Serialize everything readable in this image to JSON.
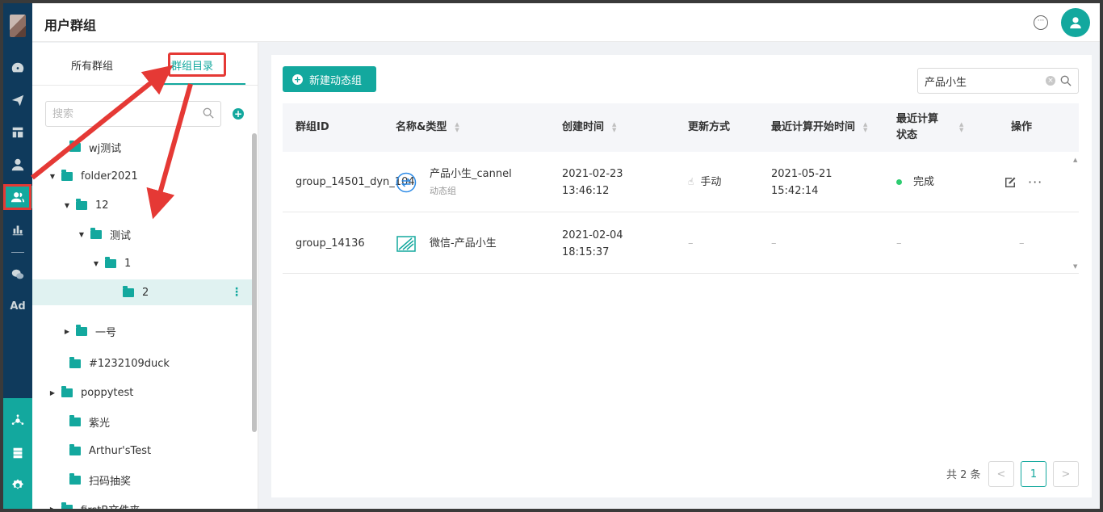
{
  "header": {
    "title": "用户群组"
  },
  "tree": {
    "tabs": [
      {
        "label": "所有群组"
      },
      {
        "label": "群组目录"
      }
    ],
    "search_placeholder": "搜索",
    "items": [
      {
        "label": "wj测试"
      },
      {
        "label": "folder2021"
      },
      {
        "label": "12"
      },
      {
        "label": "测试"
      },
      {
        "label": "1"
      },
      {
        "label": "2"
      },
      {
        "label": "一号"
      },
      {
        "label": "#1232109duck"
      },
      {
        "label": "poppytest"
      },
      {
        "label": "紫光"
      },
      {
        "label": "Arthur'sTest"
      },
      {
        "label": "扫码抽奖"
      },
      {
        "label": "firstB文件夹"
      }
    ]
  },
  "sidebar": {
    "icons": [
      "dashboard-icon",
      "send-icon",
      "layout-icon",
      "user-icon",
      "user-group-icon",
      "chart-icon",
      "wechat-icon",
      "ad-icon",
      "hub-icon",
      "server-icon",
      "settings-icon"
    ],
    "ad_label": "Ad"
  },
  "main": {
    "new_button_label": "新建动态组",
    "search_value": "产品小生",
    "columns": [
      {
        "label": "群组ID"
      },
      {
        "label": "名称&类型"
      },
      {
        "label": "创建时间"
      },
      {
        "label": "更新方式"
      },
      {
        "label": "最近计算开始时间"
      },
      {
        "label": "最近计算状态"
      },
      {
        "label": "操作"
      }
    ],
    "rows": [
      {
        "id": "group_14501_dyn_104",
        "name": "产品小生_cannel",
        "type": "动态组",
        "created": "2021-02-23 13:46:12",
        "update_mode": "手动",
        "last_calc_start": "2021-05-21 15:42:14",
        "last_calc_status": "完成"
      },
      {
        "id": "group_14136",
        "name": "微信-产品小生",
        "type": "",
        "created": "2021-02-04 18:15:37",
        "update_mode": "–",
        "last_calc_start": "–",
        "last_calc_status": "–",
        "ops": "–"
      }
    ],
    "pager": {
      "total": "共 2 条",
      "current": "1",
      "prev": "<",
      "next": ">"
    }
  },
  "colors": {
    "accent": "#13a89e",
    "rail": "#0f3a5c",
    "annotation": "#e53935"
  }
}
